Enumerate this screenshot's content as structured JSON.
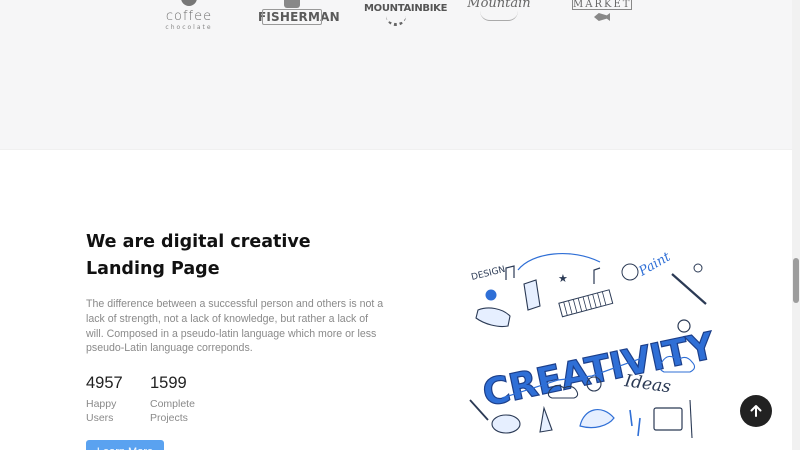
{
  "logos": {
    "coffee": {
      "name": "coffee",
      "sub": "chocolate"
    },
    "fisherman": {
      "name": "FISHERMAN"
    },
    "mountainbike": {
      "name": "MOUNTAINBIKE"
    },
    "mountain": {
      "name": "Mountain"
    },
    "market": {
      "name": "MARKET"
    }
  },
  "about": {
    "title": "We are digital creative Landing Page",
    "description": "The difference between a successful person and others is not a lack of strength, not a lack of knowledge, but rather a lack of will. Composed in a pseudo-latin language which more or less pseudo-Latin language correponds.",
    "stats": [
      {
        "value": "4957",
        "label": "Happy Users"
      },
      {
        "value": "1599",
        "label": "Complete Projects"
      }
    ],
    "button_label": "Learn More"
  },
  "illustration": {
    "main_word": "CREATIVITY",
    "words": [
      "DESIGN",
      "Paint",
      "Ideas"
    ]
  },
  "colors": {
    "accent": "#5aa2f0",
    "doodle": "#2f6fd6",
    "ink": "#2b3a55"
  },
  "icons": {
    "scroll_top": "arrow-up-icon"
  }
}
